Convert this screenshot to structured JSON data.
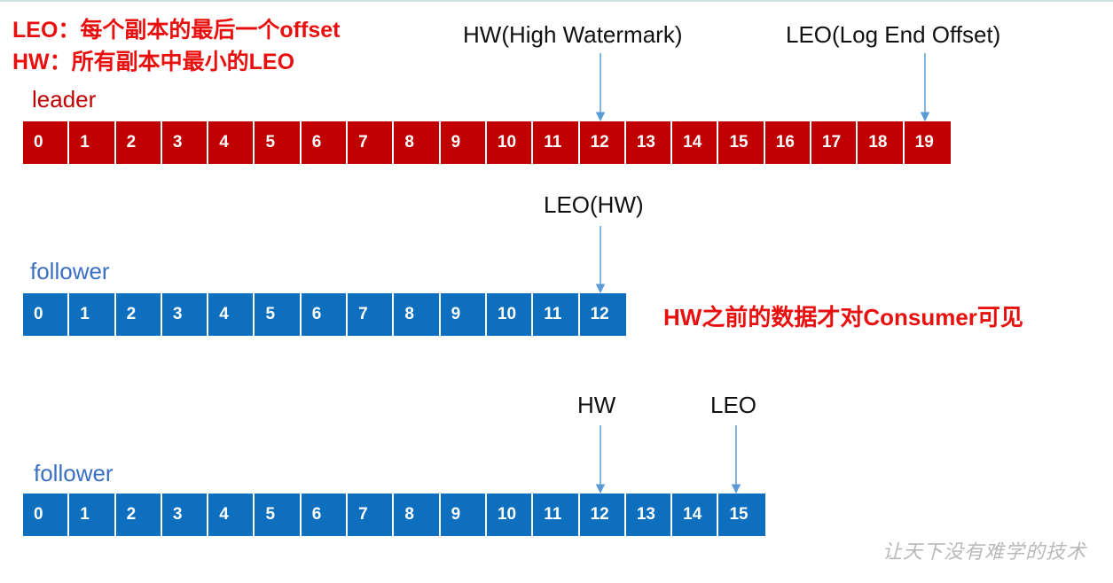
{
  "definitions": {
    "leo": "LEO：每个副本的最后一个offset",
    "hw": "HW：所有副本中最小的LEO"
  },
  "annotations": {
    "leader_hw": "HW(High Watermark)",
    "leader_leo": "LEO(Log End Offset)",
    "follower1_leo_hw": "LEO(HW)",
    "follower2_hw": "HW",
    "follower2_leo": "LEO"
  },
  "rows": {
    "leader": {
      "label": "leader",
      "color": "#c00000",
      "cells": [
        "0",
        "1",
        "2",
        "3",
        "4",
        "5",
        "6",
        "7",
        "8",
        "9",
        "10",
        "11",
        "12",
        "13",
        "14",
        "15",
        "16",
        "17",
        "18",
        "19"
      ]
    },
    "follower1": {
      "label": "follower",
      "color": "#0d6fbe",
      "cells": [
        "0",
        "1",
        "2",
        "3",
        "4",
        "5",
        "6",
        "7",
        "8",
        "9",
        "10",
        "11",
        "12"
      ]
    },
    "follower2": {
      "label": "follower",
      "color": "#0d6fbe",
      "cells": [
        "0",
        "1",
        "2",
        "3",
        "4",
        "5",
        "6",
        "7",
        "8",
        "9",
        "10",
        "11",
        "12",
        "13",
        "14",
        "15"
      ]
    }
  },
  "note": "HW之前的数据才对Consumer可见",
  "watermark": "让天下没有难学的技术",
  "colors": {
    "red_text": "#e8100f",
    "leader_label": "#c00000",
    "follower_label": "#3a6fc4",
    "arrow": "#5b9bd5"
  }
}
